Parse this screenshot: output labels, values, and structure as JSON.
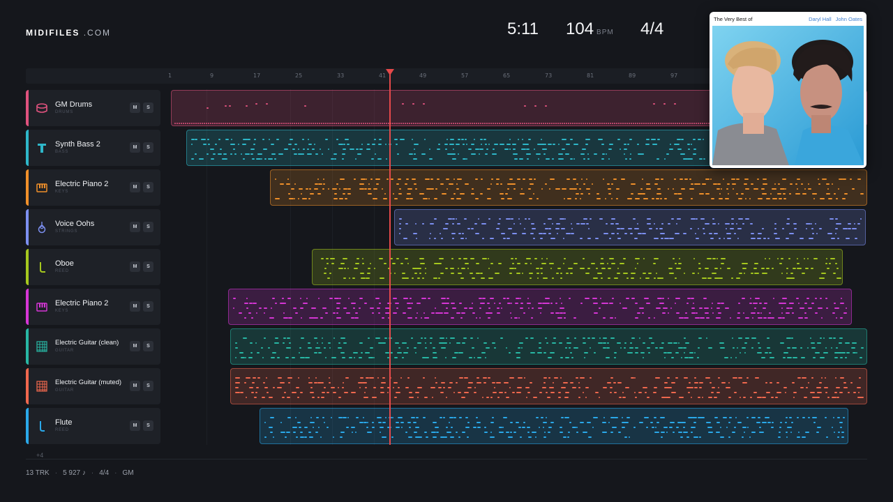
{
  "brand": {
    "name_bold": "MIDIFILES",
    "name_light": ".COM"
  },
  "transport": {
    "time": "5:11",
    "tempo": "104",
    "tempo_unit": "BPM",
    "signature": "4/4"
  },
  "ruler": {
    "ticks": [
      "1",
      "9",
      "17",
      "25",
      "33",
      "41",
      "49",
      "57",
      "65",
      "73",
      "81",
      "89",
      "97"
    ]
  },
  "colors": {
    "playhead": "#e6494a",
    "background": "#15171c"
  },
  "tracks": [
    {
      "name": "GM Drums",
      "category": "DRUMS",
      "color": "#e0527e",
      "icon": "drum-icon",
      "mute": "M",
      "solo": "S"
    },
    {
      "name": "Synth Bass 2",
      "category": "BASS",
      "color": "#2eb7c9",
      "icon": "bass-icon",
      "mute": "M",
      "solo": "S"
    },
    {
      "name": "Electric Piano 2",
      "category": "KEYS",
      "color": "#f0902a",
      "icon": "piano-icon",
      "mute": "M",
      "solo": "S"
    },
    {
      "name": "Voice Oohs",
      "category": "STRINGS",
      "color": "#7c8ff0",
      "icon": "violin-icon",
      "mute": "M",
      "solo": "S"
    },
    {
      "name": "Oboe",
      "category": "REED",
      "color": "#a6c81e",
      "icon": "reed-icon",
      "mute": "M",
      "solo": "S"
    },
    {
      "name": "Electric Piano 2",
      "category": "KEYS",
      "color": "#d636d6",
      "icon": "piano-icon",
      "mute": "M",
      "solo": "S"
    },
    {
      "name": "Electric Guitar (clean)",
      "category": "GUITAR",
      "color": "#28b7a4",
      "icon": "guitar-icon",
      "mute": "M",
      "solo": "S"
    },
    {
      "name": "Electric Guitar (muted)",
      "category": "GUITAR",
      "color": "#f0684e",
      "icon": "guitar-icon",
      "mute": "M",
      "solo": "S"
    },
    {
      "name": "Flute",
      "category": "REED",
      "color": "#2aa9ea",
      "icon": "flute-icon",
      "mute": "M",
      "solo": "S"
    }
  ],
  "more_tracks": "+4",
  "footer": {
    "tracks": "13 TRK",
    "notes": "5 927 ♪",
    "signature": "4/4",
    "standard": "GM"
  },
  "album": {
    "title": "The Very Best of",
    "artist1": "Daryl Hall",
    "artist2": "John Oates"
  }
}
